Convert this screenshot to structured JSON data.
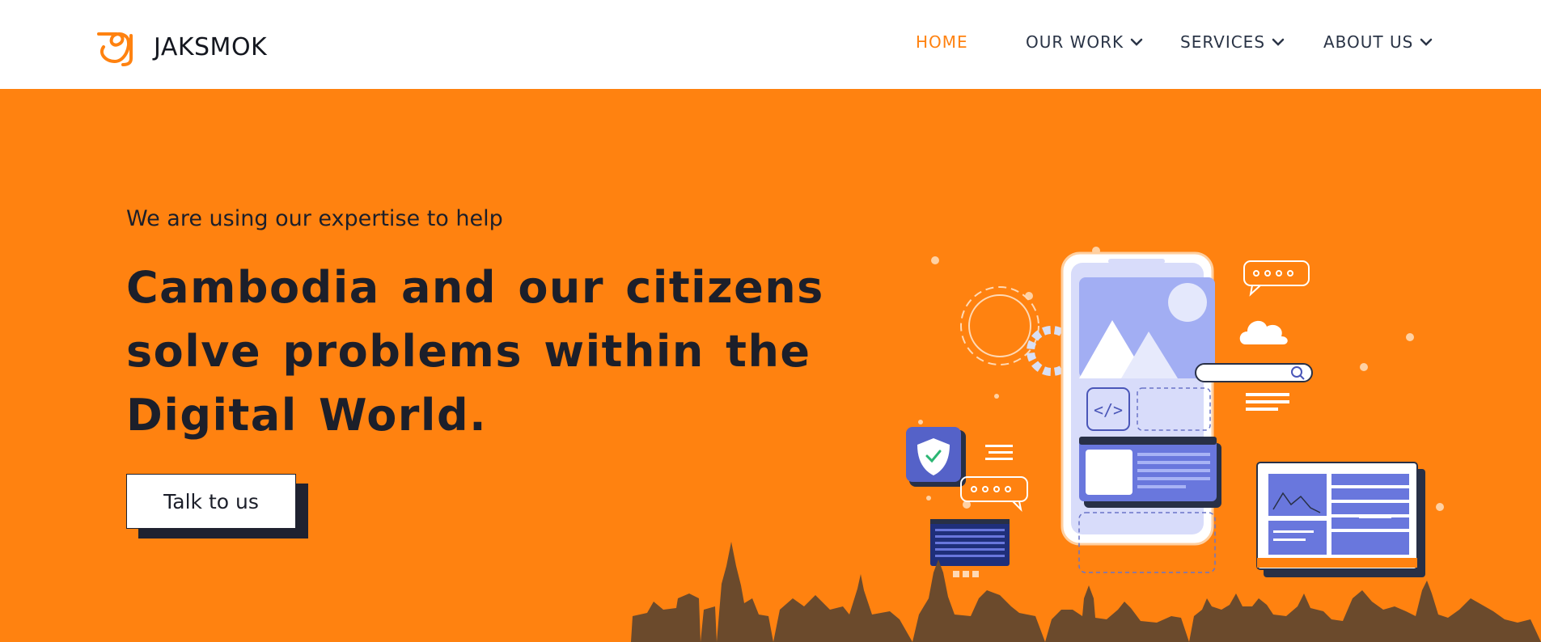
{
  "brand": {
    "name": "JAKSMOK",
    "color": "#ff8210"
  },
  "nav": {
    "items": [
      {
        "label": "HOME",
        "active": true,
        "has_dropdown": false
      },
      {
        "label": "OUR WORK",
        "active": false,
        "has_dropdown": true
      },
      {
        "label": "SERVICES",
        "active": false,
        "has_dropdown": true
      },
      {
        "label": "ABOUT US",
        "active": false,
        "has_dropdown": true
      }
    ]
  },
  "hero": {
    "eyebrow": "We are using our expertise to help",
    "headline": "Cambodia and our citizens solve problems within the Digital World.",
    "cta_label": "Talk to us",
    "background": "#ff8210"
  },
  "icons": [
    "logo-mark-icon",
    "chevron-down-icon",
    "shield-check-icon",
    "code-icon",
    "search-icon",
    "cloud-icon",
    "gear-icon",
    "chat-bubble-icon"
  ]
}
